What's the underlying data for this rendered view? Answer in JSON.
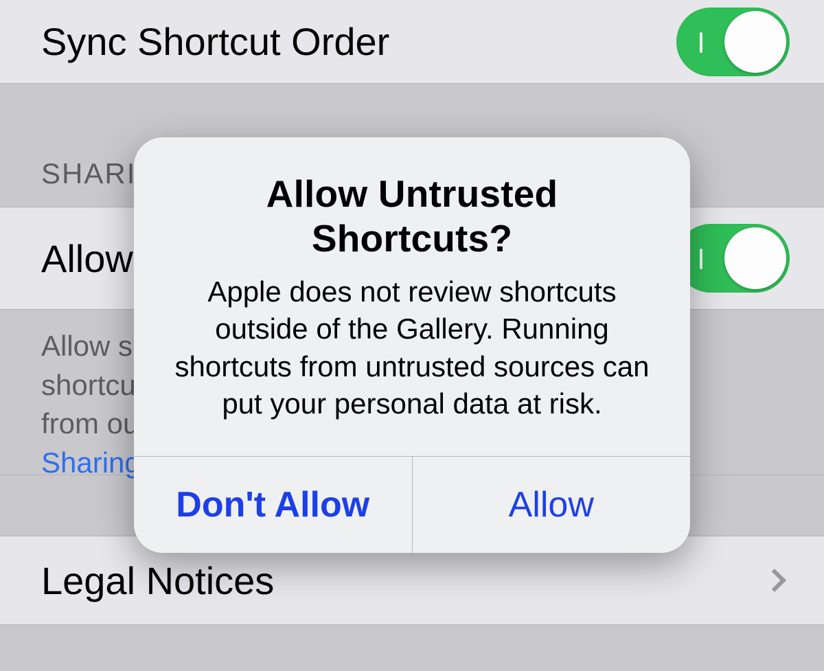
{
  "settings": {
    "sync_label": "Sync Shortcut Order",
    "sync_on": true,
    "sharing_header": "SHARING",
    "allow_label": "Allow Untrusted Shortcuts",
    "allow_on": true,
    "footer_line1": "Allow shortcuts from outside the Gallery. Running shortcuts",
    "footer_line2": "from outside the Gallery can put your data at risk.",
    "footer_link": "Sharing Security",
    "legal_label": "Legal Notices"
  },
  "dialog": {
    "title": "Allow Untrusted Shortcuts?",
    "message": "Apple does not review shortcuts outside of the Gallery. Running shortcuts from untrusted sources can put your personal data at risk.",
    "cancel": "Don't Allow",
    "confirm": "Allow"
  }
}
